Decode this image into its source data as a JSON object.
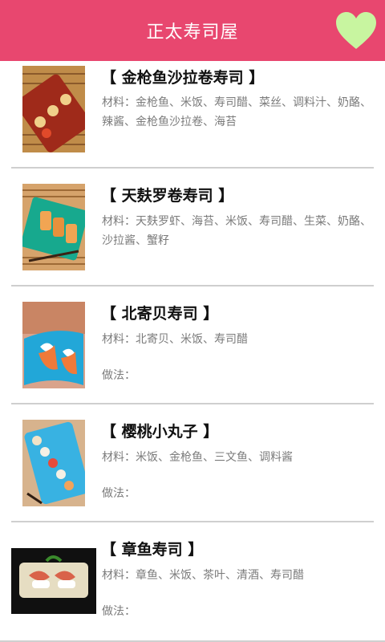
{
  "header": {
    "title": "正太寿司屋"
  },
  "colors": {
    "header_bg": "#e8476f",
    "heart": "#c8f5a0"
  },
  "items": [
    {
      "title": "【 金枪鱼沙拉卷寿司 】",
      "materials": "材料：金枪鱼、米饭、寿司醋、菜丝、调料汁、奶酪、辣酱、金枪鱼沙拉卷、海苔",
      "method": ""
    },
    {
      "title": "【 天麸罗卷寿司 】",
      "materials": "材料：天麸罗虾、海苔、米饭、寿司醋、生菜、奶酪、沙拉酱、蟹籽",
      "method": ""
    },
    {
      "title": "【 北寄贝寿司 】",
      "materials": "材料：北寄贝、米饭、寿司醋",
      "method": "做法："
    },
    {
      "title": "【 樱桃小丸子 】",
      "materials": "材料：米饭、金枪鱼、三文鱼、调料酱",
      "method": "做法："
    },
    {
      "title": "【 章鱼寿司 】",
      "materials": "材料：章鱼、米饭、茶叶、清酒、寿司醋",
      "method": "做法："
    }
  ]
}
